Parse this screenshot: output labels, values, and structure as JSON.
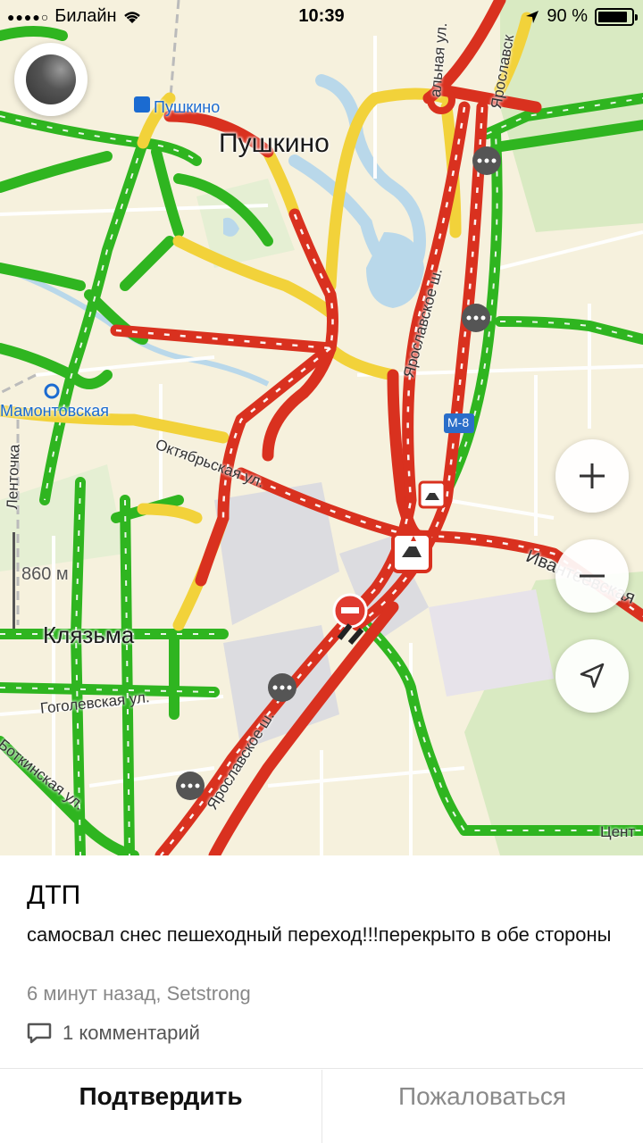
{
  "status_bar": {
    "carrier": "Билайн",
    "time": "10:39",
    "battery": "90 %",
    "battery_level": 0.9
  },
  "map": {
    "labels": {
      "city_pushkino": "Пушкино",
      "station_pushkino": "Пушкино",
      "station_mamontovskaya": "Мамонтовская",
      "district_klyazma": "Клязьма",
      "street_oktyabrskaya": "Октябрьская ул.",
      "street_yaroslavskoe_sh": "Ярославское ш.",
      "street_yaroslavskoe_lower": "Ярославское ш.",
      "street_ivanteevskaya": "Ивантеевская",
      "street_gogolevskaya": "Гоголевская ул.",
      "street_botkinskaya": "Боткинская ул.",
      "street_centr": "Цент",
      "street_lentochka": "Ленточка",
      "street_top_partial": "альная ул.",
      "street_yaroslavsk_top": "Ярославск",
      "highway_badge": "M-8"
    },
    "scale_label": "860 м",
    "colors": {
      "jam_red": "#d9311f",
      "slow_yellow": "#f2d23a",
      "free_green": "#2fb520",
      "water": "#b9d8ea",
      "park": "#d9eac2"
    }
  },
  "event": {
    "title": "ДТП",
    "description": "самосвал снес пешеходный переход!!!перекрыто в обе стороны",
    "meta": "6 минут назад, Setstrong",
    "comments": "1 комментарий"
  },
  "actions": {
    "confirm": "Подтвердить",
    "report": "Пожаловаться"
  }
}
